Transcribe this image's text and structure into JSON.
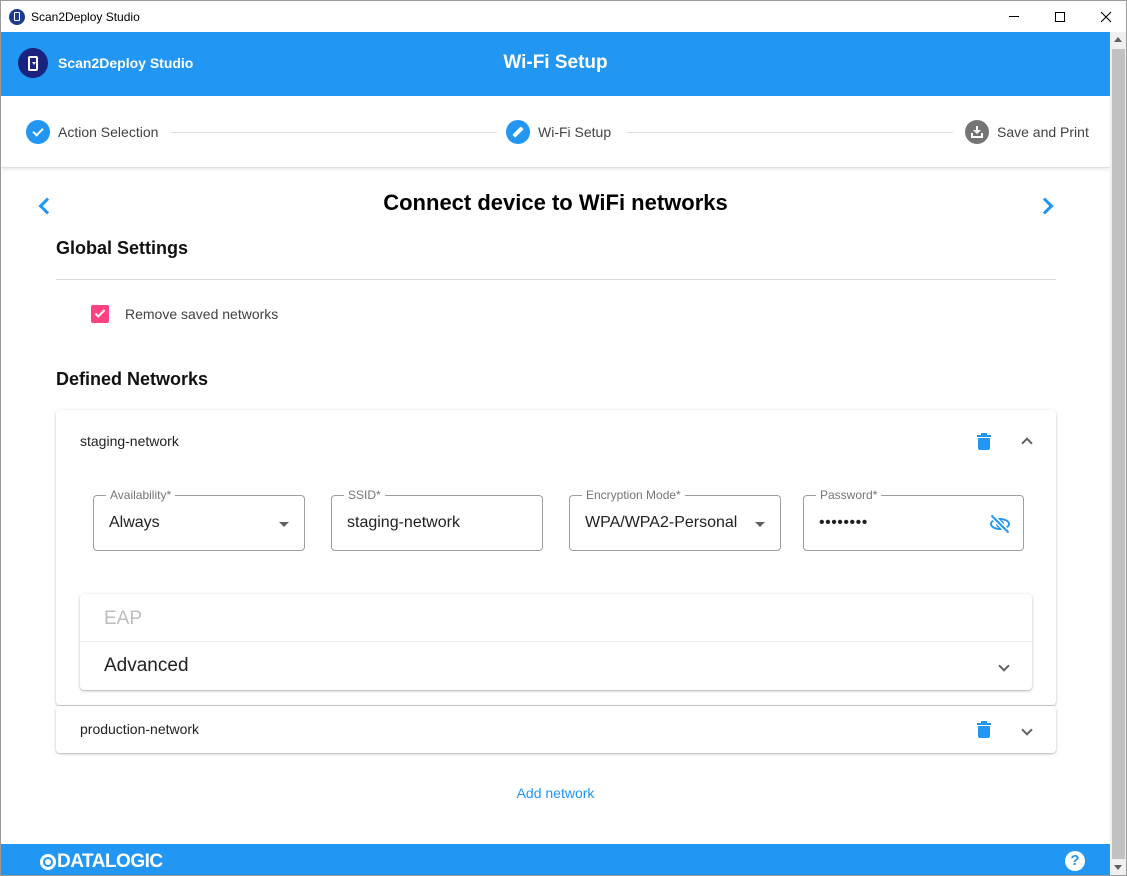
{
  "window": {
    "title": "Scan2Deploy Studio"
  },
  "header": {
    "brand": "Scan2Deploy Studio",
    "title": "Wi-Fi Setup"
  },
  "stepper": {
    "steps": [
      {
        "label": "Action Selection",
        "state": "done",
        "icon": "check-icon"
      },
      {
        "label": "Wi-Fi Setup",
        "state": "active",
        "icon": "pencil-icon"
      },
      {
        "label": "Save and Print",
        "state": "pending",
        "icon": "download-icon"
      }
    ]
  },
  "page": {
    "title": "Connect device to WiFi networks",
    "global_settings_title": "Global Settings",
    "remove_saved_label": "Remove saved networks",
    "remove_saved_checked": true,
    "defined_networks_title": "Defined Networks",
    "add_network_label": "Add network"
  },
  "networks": [
    {
      "name": "staging-network",
      "expanded": true,
      "fields": {
        "availability": {
          "label": "Availability*",
          "value": "Always"
        },
        "ssid": {
          "label": "SSID*",
          "value": "staging-network"
        },
        "encryption": {
          "label": "Encryption Mode*",
          "value": "WPA/WPA2-Personal"
        },
        "password": {
          "label": "Password*",
          "value": "••••••••"
        }
      },
      "sections": {
        "eap": "EAP",
        "advanced": "Advanced"
      }
    },
    {
      "name": "production-network",
      "expanded": false
    }
  ],
  "footer": {
    "logo": "DATALOGIC",
    "help": "?"
  },
  "colors": {
    "primary": "#2196f3",
    "checkbox": "#ff4081",
    "brand_circle": "#1a237e",
    "step_pending": "#757575"
  }
}
